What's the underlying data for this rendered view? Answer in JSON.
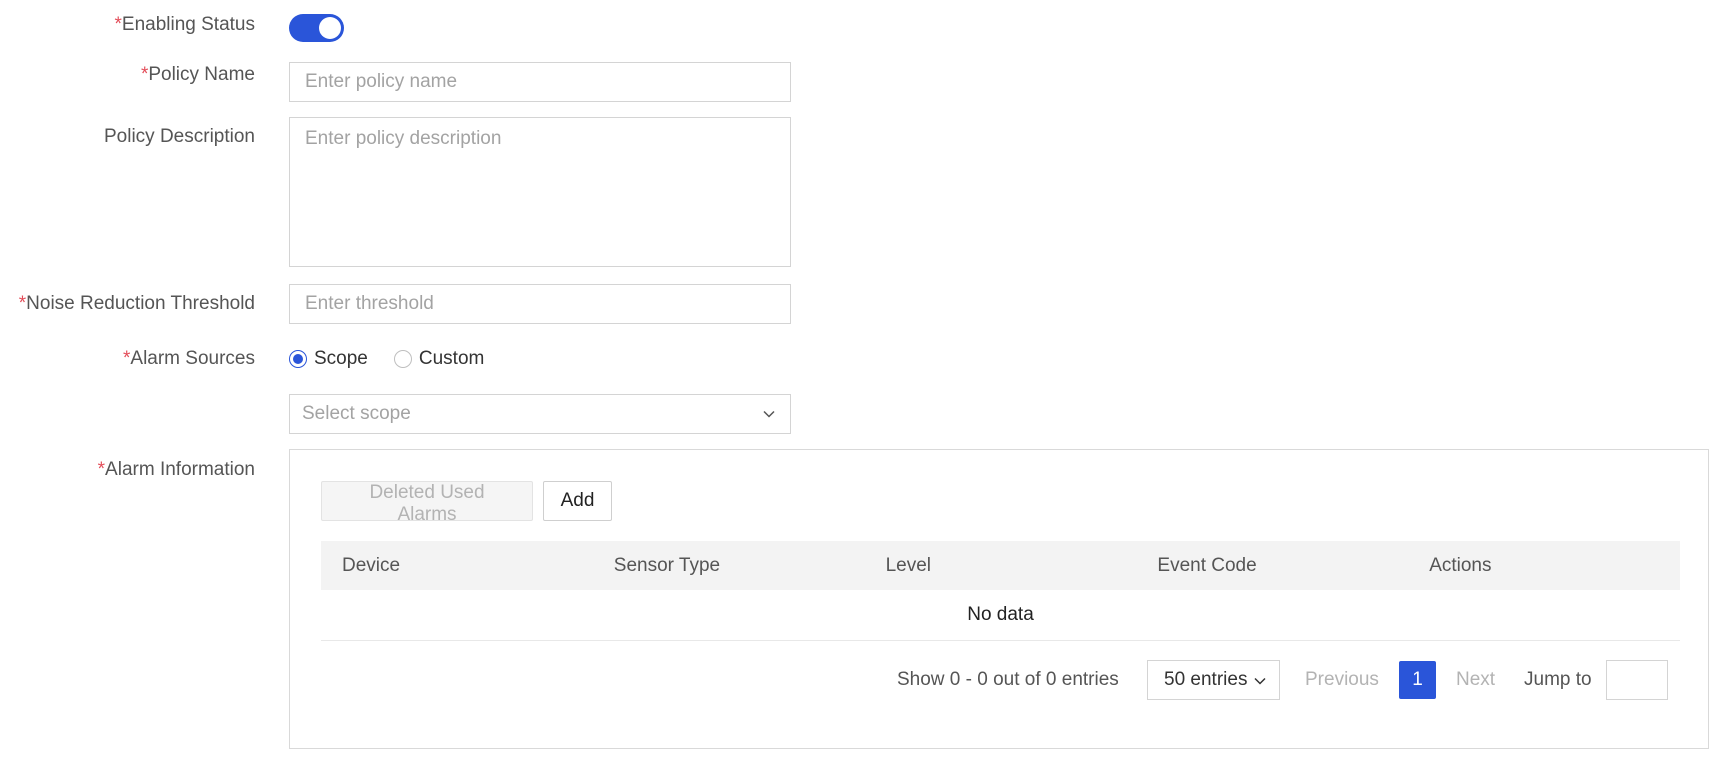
{
  "form": {
    "enabling_status": {
      "required_mark": "*",
      "label": "Enabling Status",
      "value": true
    },
    "policy_name": {
      "required_mark": "*",
      "label": "Policy Name",
      "placeholder": "Enter policy name",
      "value": ""
    },
    "policy_description": {
      "label": "Policy Description",
      "placeholder": "Enter policy description",
      "value": ""
    },
    "noise_threshold": {
      "required_mark": "*",
      "label": "Noise Reduction Threshold",
      "placeholder": "Enter threshold",
      "value": ""
    },
    "alarm_sources": {
      "required_mark": "*",
      "label": "Alarm Sources",
      "options": [
        {
          "label": "Scope",
          "checked": true
        },
        {
          "label": "Custom",
          "checked": false
        }
      ],
      "scope_placeholder": "Select scope"
    },
    "alarm_information": {
      "required_mark": "*",
      "label": "Alarm Information"
    }
  },
  "alarm_table": {
    "delete_button": "Deleted Used Alarms",
    "add_button": "Add",
    "columns": [
      "Device",
      "Sensor Type",
      "Level",
      "Event Code",
      "Actions"
    ],
    "empty_text": "No data"
  },
  "pagination": {
    "summary": "Show 0 - 0 out of 0 entries",
    "per_page": "50 entries",
    "previous": "Previous",
    "current_page": "1",
    "next": "Next",
    "jump_label": "Jump to",
    "jump_value": ""
  },
  "colors": {
    "accent": "#2a55d9",
    "required": "#e34d59"
  }
}
